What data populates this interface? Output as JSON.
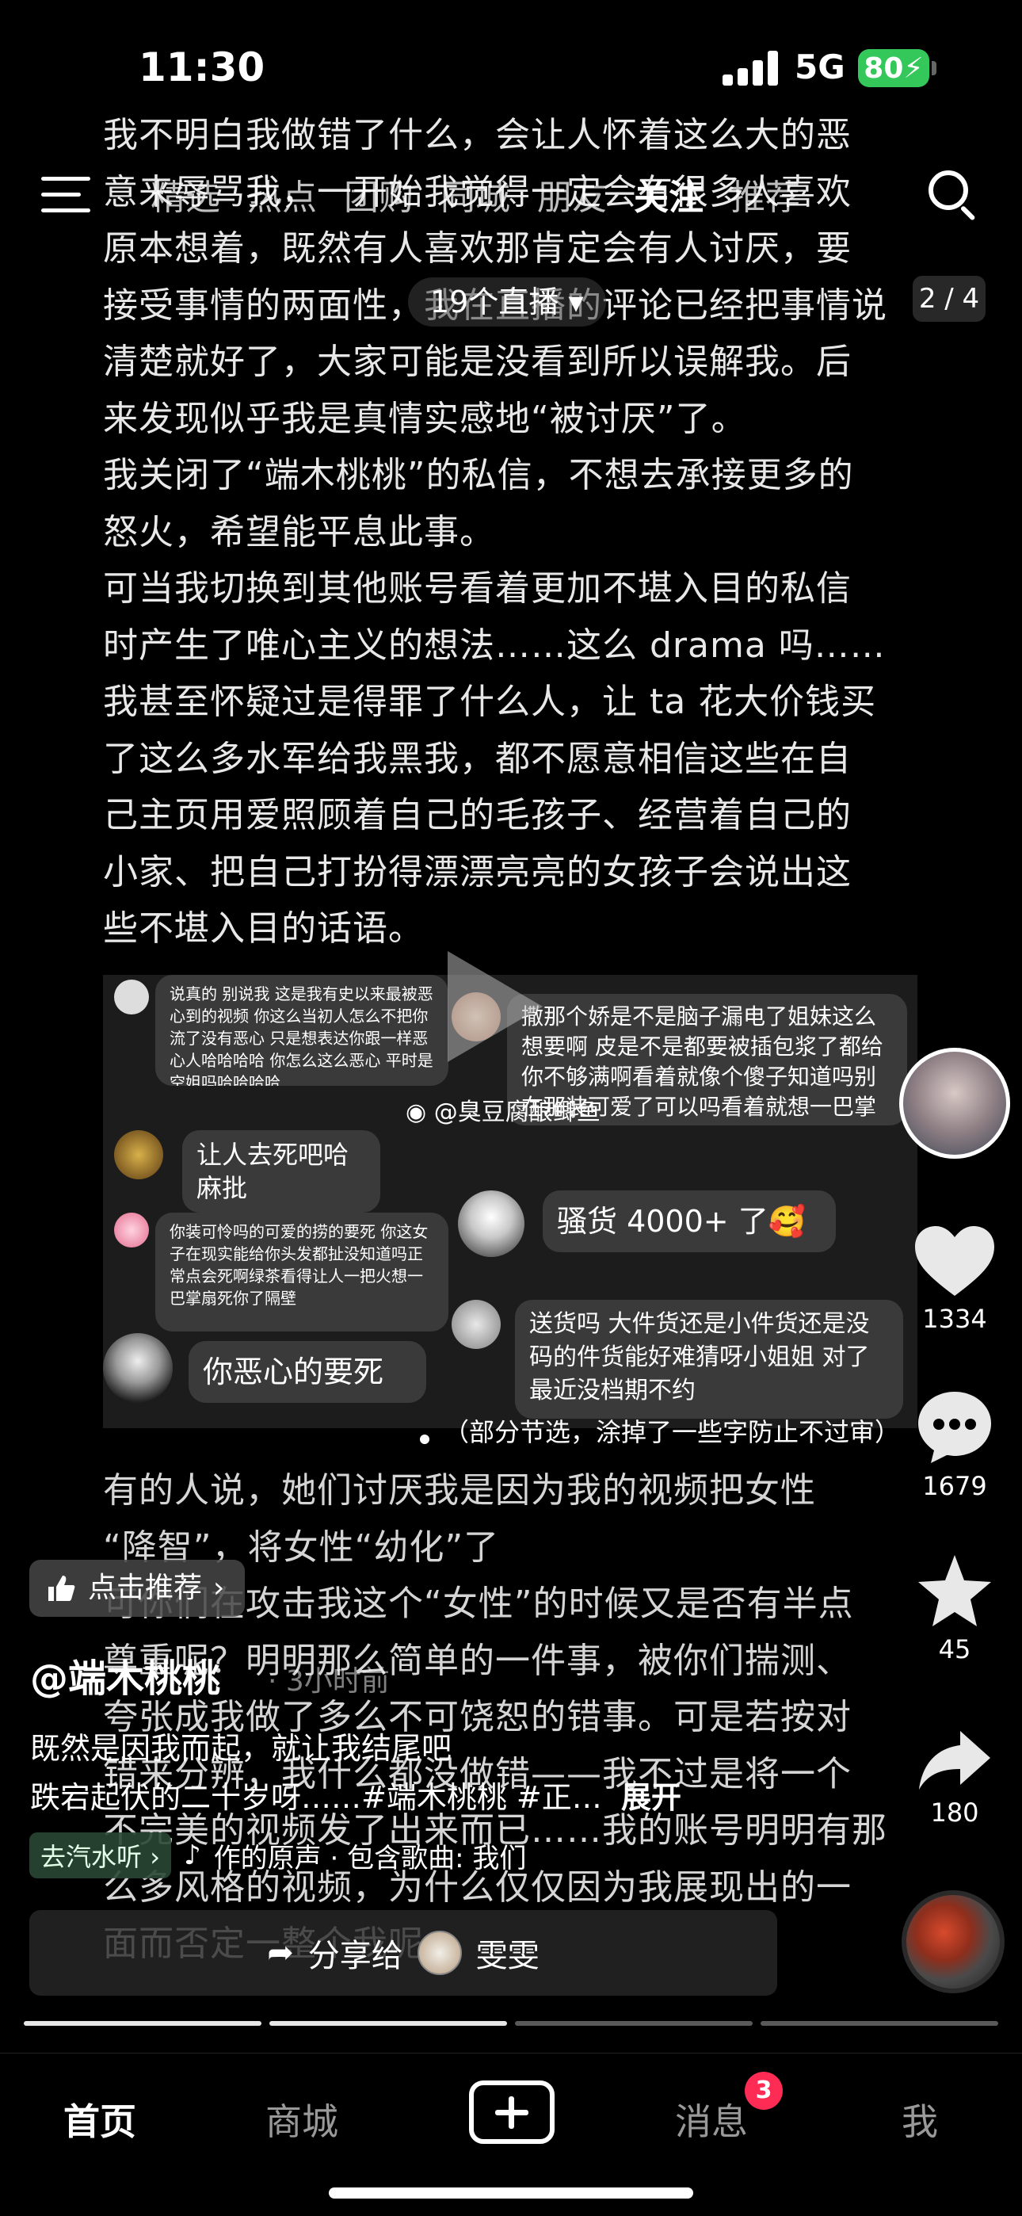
{
  "status_bar": {
    "time": "11:30",
    "network": "5G",
    "battery": "80"
  },
  "article_top": [
    "我不明白我做错了什么，会让人怀着这么大的恶",
    "意来辱骂我，一开始我觉得一定会有很多人喜欢",
    "原本想着，既然有人喜欢那肯定会有人讨厌，要",
    "接受事情的两面性，我在直播的评论已经把事情说",
    "清楚就好了，大家可能是没看到所以误解我。后",
    "来发现似乎我是真情实感地“被讨厌”了。",
    "我关闭了“端木桃桃”的私信，不想去承接更多的",
    "怒火，希望能平息此事。",
    "可当我切换到其他账号看着更加不堪入目的私信",
    "时产生了唯心主义的想法……这么 drama 吗……",
    "我甚至怀疑过是得罪了什么人，让 ta 花大价钱买",
    "了这么多水军给我黑我，都不愿意相信这些在自",
    "己主页用爱照顾着自己的毛孩子、经营着自己的",
    "小家、把自己打扮得漂漂亮亮的女孩子会说出这",
    "些不堪入目的话语。"
  ],
  "article_bottom": [
    "有的人说，她们讨厌我是因为我的视频把女性",
    "“降智”，将女性“幼化”了",
    "可你们在攻击我这个“女性”的时候又是否有半点",
    "尊重呢？明明那么简单的一件事，被你们揣测、",
    "夸张成我做了多么不可饶恕的错事。可是若按对",
    "错来分辨，我什么都没做错——我不过是将一个",
    "不完美的视频发了出来而已……我的账号明明有那",
    "么多风格的视频，为什么仅仅因为我展现出的一",
    "面而否定一整个我呢"
  ],
  "topnav": {
    "tabs": [
      "精选",
      "热点",
      "团购",
      "同城",
      "朋友",
      "关注",
      "推荐"
    ],
    "active": "关注"
  },
  "overlay_pill": "19个直播",
  "page_indicator": "2 / 4",
  "collage": {
    "left": [
      {
        "text": "说真的 别说我 这是我有史以来最被恶心到的视频 你这么当初人怎么不把你流了没有恶心 只是想表达你跟一样恶心人哈哈哈哈 你怎么这么恶心 平时是空姐吗哈哈哈哈"
      },
      {
        "text": "让人去死吧哈麻批"
      },
      {
        "text": "你装可怜吗的可爱的捞的要死 你这女子在现实能给你头发都扯没知道吗正常点会死啊绿茶看得让人一把火想一巴掌扇死你了隔壁"
      },
      {
        "text": "你恶心的要死"
      }
    ],
    "right": [
      {
        "text": "撒那个娇是不是脑子漏电了姐妹这么想要啊 皮是不是都要被插包浆了都给你不够满啊看着就像个傻子知道吗别在那装可爱了可以吗看着就想一巴掌😊"
      },
      {
        "text": "骚货 4000+ 了🥰"
      },
      {
        "text": "送货吗 大件货还是小件货还是没码的件货能好难猜呀小姐姐 对了最近没档期不约"
      }
    ],
    "watermark": "@臭豆腐酿鲫鱼",
    "caption": "（部分节选，涂掉了一些字防止不过审）"
  },
  "rail": {
    "likes": "1334",
    "comments": "1679",
    "favorites": "45",
    "shares": "180"
  },
  "recommend_pill": "点击推荐",
  "author": "@端木桃桃",
  "time_ago": "· 3小时前",
  "caption_lines": [
    "既然是因我而起，就让我结尾吧",
    "跌宕起伏的二十岁呀……#端木桃桃 #正…"
  ],
  "caption_expand": "展开",
  "music_tag": "去汽水听",
  "music_text": "作的原声 · 包含歌曲: 我们",
  "share_bar": {
    "prefix": "分享给",
    "name": "雯雯"
  },
  "tabbar": {
    "home": "首页",
    "mall": "商城",
    "messages": "消息",
    "me": "我",
    "badge": "3"
  }
}
